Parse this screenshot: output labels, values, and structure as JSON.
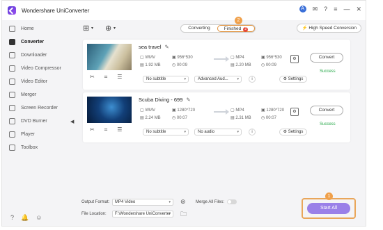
{
  "app": {
    "title": "Wondershare UniConverter",
    "user_initial": "A"
  },
  "window_controls": {
    "mail": "✉",
    "help": "?",
    "menu": "≡",
    "minimize": "—",
    "close": "✕"
  },
  "sidebar": {
    "items": [
      {
        "label": "Home",
        "active": false
      },
      {
        "label": "Converter",
        "active": true
      },
      {
        "label": "Downloader",
        "active": false
      },
      {
        "label": "Video Compressor",
        "active": false
      },
      {
        "label": "Video Editor",
        "active": false
      },
      {
        "label": "Merger",
        "active": false
      },
      {
        "label": "Screen Recorder",
        "active": false
      },
      {
        "label": "DVD Burner",
        "active": false
      },
      {
        "label": "Player",
        "active": false
      },
      {
        "label": "Toolbox",
        "active": false
      }
    ],
    "footer": {
      "help": "?",
      "notifications": "🔔",
      "feedback": "☺"
    },
    "collapse_glyph": "◀"
  },
  "toolbar": {
    "add_files_glyph": "⊞",
    "add_media_glyph": "⊕",
    "tabs": {
      "converting": "Converting",
      "finished": "Finished",
      "finished_count": "2"
    },
    "high_speed": "High Speed Conversion",
    "callout_finished": "2",
    "callout_start": "1"
  },
  "files": [
    {
      "name": "sea travel",
      "src": {
        "format": "WMV",
        "resolution": "956*530",
        "size": "1.92 MB",
        "duration": "00:09"
      },
      "dst": {
        "format": "MP4",
        "resolution": "956*530",
        "size": "2.20 MB",
        "duration": "00:09"
      },
      "subtitle": "No subtitle",
      "audio": "Advanced Aud...",
      "settings": "Settings",
      "convert": "Convert",
      "status": "Success"
    },
    {
      "name": "Scuba Diving - 699",
      "src": {
        "format": "WMV",
        "resolution": "1280*720",
        "size": "2.24 MB",
        "duration": "00:07"
      },
      "dst": {
        "format": "MP4",
        "resolution": "1280*720",
        "size": "2.31 MB",
        "duration": "00:07"
      },
      "subtitle": "No subtitle",
      "audio": "No audio",
      "settings": "Settings",
      "convert": "Convert",
      "status": "Success"
    }
  ],
  "footer": {
    "output_format_label": "Output Format:",
    "output_format_value": "MP4 Video",
    "merge_label": "Merge All Files:",
    "file_location_label": "File Location:",
    "file_location_value": "F:\\Wondershare UniConverter",
    "start_all": "Start All"
  },
  "colors": {
    "accent": "#9a80e8",
    "success": "#27a849",
    "callout": "#f0a04a",
    "badge": "#e5483a"
  }
}
